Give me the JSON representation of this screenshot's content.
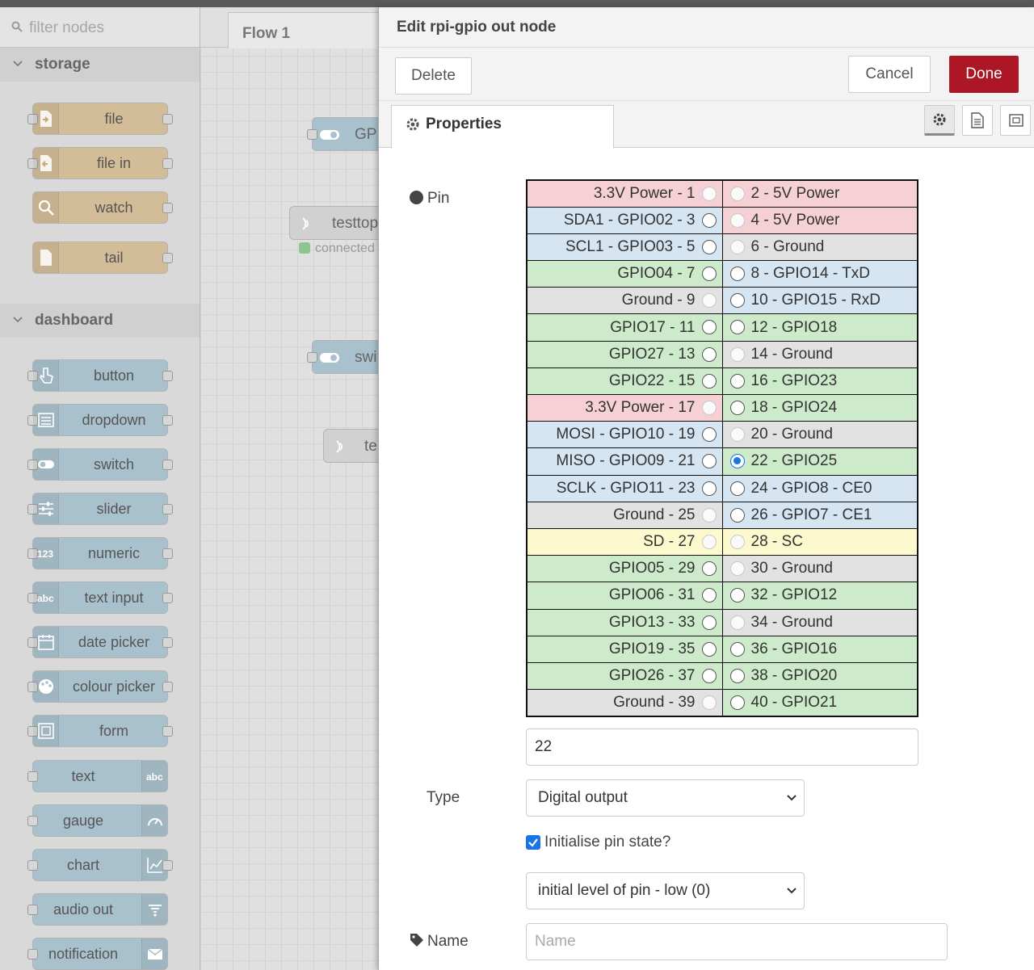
{
  "palette": {
    "filter_placeholder": "filter nodes",
    "categories": [
      {
        "label": "storage"
      },
      {
        "label": "dashboard"
      }
    ],
    "storage_nodes": [
      "file",
      "file in",
      "watch",
      "tail"
    ],
    "dashboard_nodes": [
      "button",
      "dropdown",
      "switch",
      "slider",
      "numeric",
      "text input",
      "date picker",
      "colour picker",
      "form",
      "text",
      "gauge",
      "chart",
      "audio out",
      "notification"
    ]
  },
  "workspace": {
    "tab": "Flow 1",
    "nodes": [
      "GP",
      "testtop",
      "swi",
      "te"
    ],
    "status": "connected"
  },
  "tray": {
    "title": "Edit rpi-gpio out node",
    "delete_label": "Delete",
    "cancel_label": "Cancel",
    "done_label": "Done",
    "properties_tab": "Properties",
    "pin_label": "Pin",
    "pins": [
      {
        "left": "3.3V Power - 1",
        "lcolor": "pink",
        "ldis": true,
        "right": "2 - 5V Power",
        "rcolor": "pink",
        "rdis": true
      },
      {
        "left": "SDA1 - GPIO02 - 3",
        "lcolor": "blue",
        "ldis": false,
        "right": "4 - 5V Power",
        "rcolor": "pink",
        "rdis": true
      },
      {
        "left": "SCL1 - GPIO03 - 5",
        "lcolor": "blue",
        "ldis": false,
        "right": "6 - Ground",
        "rcolor": "grey",
        "rdis": true
      },
      {
        "left": "GPIO04 - 7",
        "lcolor": "green",
        "ldis": false,
        "right": "8 - GPIO14 - TxD",
        "rcolor": "blue",
        "rdis": false
      },
      {
        "left": "Ground - 9",
        "lcolor": "grey",
        "ldis": true,
        "right": "10 - GPIO15 - RxD",
        "rcolor": "blue",
        "rdis": false
      },
      {
        "left": "GPIO17 - 11",
        "lcolor": "green",
        "ldis": false,
        "right": "12 - GPIO18",
        "rcolor": "green",
        "rdis": false
      },
      {
        "left": "GPIO27 - 13",
        "lcolor": "green",
        "ldis": false,
        "right": "14 - Ground",
        "rcolor": "grey",
        "rdis": true
      },
      {
        "left": "GPIO22 - 15",
        "lcolor": "green",
        "ldis": false,
        "right": "16 - GPIO23",
        "rcolor": "green",
        "rdis": false
      },
      {
        "left": "3.3V Power - 17",
        "lcolor": "pink",
        "ldis": true,
        "right": "18 - GPIO24",
        "rcolor": "green",
        "rdis": false
      },
      {
        "left": "MOSI - GPIO10 - 19",
        "lcolor": "blue",
        "ldis": false,
        "right": "20 - Ground",
        "rcolor": "grey",
        "rdis": true
      },
      {
        "left": "MISO - GPIO09 - 21",
        "lcolor": "blue",
        "ldis": false,
        "right": "22 - GPIO25",
        "rcolor": "green",
        "rdis": false,
        "rsel": true
      },
      {
        "left": "SCLK - GPIO11 - 23",
        "lcolor": "blue",
        "ldis": false,
        "right": "24 - GPIO8 - CE0",
        "rcolor": "blue",
        "rdis": false
      },
      {
        "left": "Ground - 25",
        "lcolor": "grey",
        "ldis": true,
        "right": "26 - GPIO7 - CE1",
        "rcolor": "blue",
        "rdis": false
      },
      {
        "left": "SD - 27",
        "lcolor": "yellow",
        "ldis": true,
        "right": "28 - SC",
        "rcolor": "yellow",
        "rdis": true
      },
      {
        "left": "GPIO05 - 29",
        "lcolor": "green",
        "ldis": false,
        "right": "30 - Ground",
        "rcolor": "grey",
        "rdis": true
      },
      {
        "left": "GPIO06 - 31",
        "lcolor": "green",
        "ldis": false,
        "right": "32 - GPIO12",
        "rcolor": "green",
        "rdis": false
      },
      {
        "left": "GPIO13 - 33",
        "lcolor": "green",
        "ldis": false,
        "right": "34 - Ground",
        "rcolor": "grey",
        "rdis": true
      },
      {
        "left": "GPIO19 - 35",
        "lcolor": "green",
        "ldis": false,
        "right": "36 - GPIO16",
        "rcolor": "green",
        "rdis": false
      },
      {
        "left": "GPIO26 - 37",
        "lcolor": "green",
        "ldis": false,
        "right": "38 - GPIO20",
        "rcolor": "green",
        "rdis": false
      },
      {
        "left": "Ground - 39",
        "lcolor": "grey",
        "ldis": true,
        "right": "40 - GPIO21",
        "rcolor": "green",
        "rdis": false
      }
    ],
    "pin_value": "22",
    "type_label": "Type",
    "type_value": "Digital output",
    "init_checked": true,
    "init_label": "Initialise pin state?",
    "initial_level": "initial level of pin - low (0)",
    "name_label": "Name",
    "name_placeholder": "Name"
  }
}
